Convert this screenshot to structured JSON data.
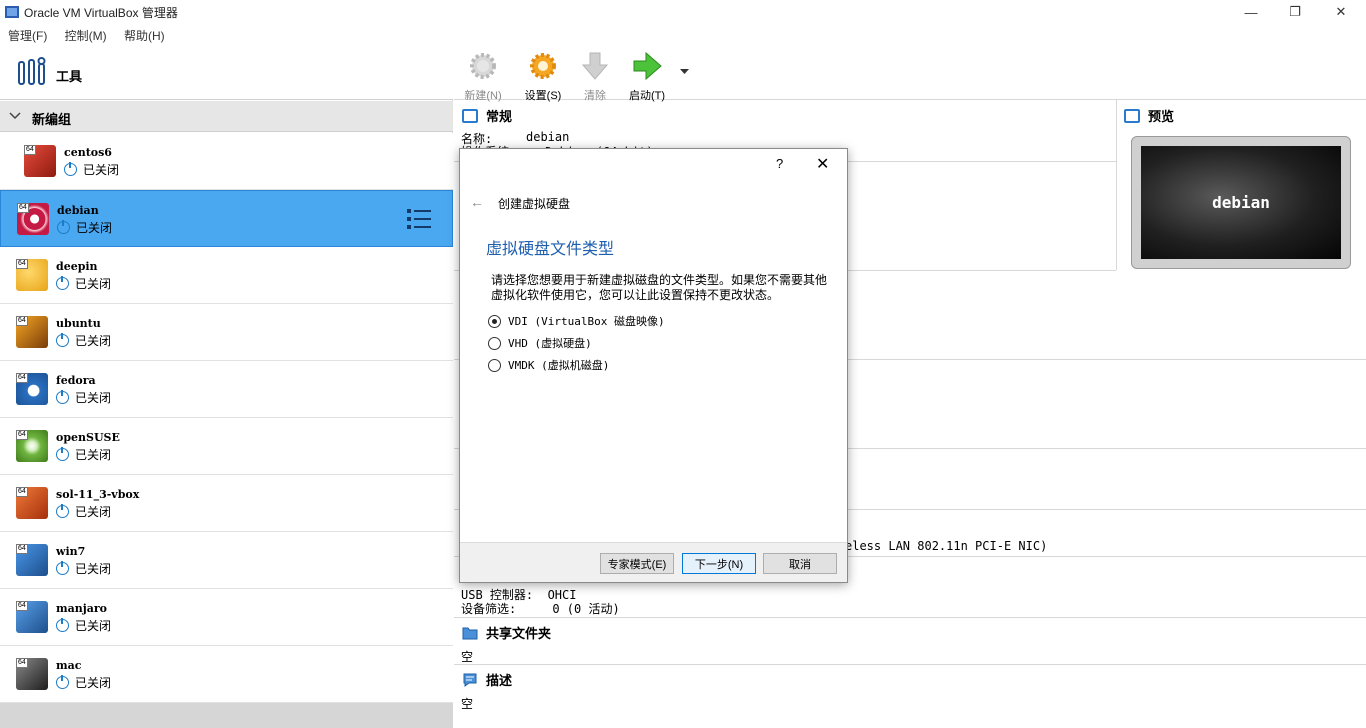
{
  "window": {
    "title": "Oracle VM VirtualBox 管理器",
    "controls": {
      "minimize": "—",
      "restore": "❐",
      "close": "✕"
    }
  },
  "menu": [
    "管理(F)",
    "控制(M)",
    "帮助(H)"
  ],
  "sidebar": {
    "tools_label": "工具",
    "group_label": "新编组",
    "vms": [
      {
        "name": "centos6",
        "status": "已关闭",
        "arch": "64",
        "color": "#c0392b"
      },
      {
        "name": "debian",
        "status": "已关闭",
        "arch": "64",
        "color": "#c41a44",
        "selected": true
      },
      {
        "name": "deepin",
        "status": "已关闭",
        "arch": "64",
        "color": "#f2b134"
      },
      {
        "name": "ubuntu",
        "status": "已关闭",
        "arch": "64",
        "color": "#e08a1e"
      },
      {
        "name": "fedora",
        "status": "已关闭",
        "arch": "64",
        "color": "#2a6fc0"
      },
      {
        "name": "openSUSE",
        "status": "已关闭",
        "arch": "64",
        "color": "#6fb43f"
      },
      {
        "name": "sol-11_3-vbox",
        "status": "已关闭",
        "arch": "64",
        "color": "#e35a1a"
      },
      {
        "name": "win7",
        "status": "已关闭",
        "arch": "64",
        "color": "#2d74c4"
      },
      {
        "name": "manjaro",
        "status": "已关闭",
        "arch": "64",
        "color": "#3a7fd0"
      },
      {
        "name": "mac",
        "status": "已关闭",
        "arch": "64",
        "color": "#3c3c3c"
      }
    ]
  },
  "toolbar": {
    "new_label": "新建(N)",
    "settings_label": "设置(S)",
    "discard_label": "清除",
    "start_label": "启动(T)"
  },
  "details": {
    "general_title": "常规",
    "name_key": "名称:",
    "name_val": "debian",
    "os_fragment": "操作系统:    Debian (64-bit)",
    "preview_title": "预览",
    "preview_text": "debian",
    "nic_fragment": "eless LAN 802.11n PCI-E NIC)",
    "usb_ctrl": "USB 控制器:  OHCI",
    "usb_filter": "设备筛选:     0 (0 活动)",
    "shared_title": "共享文件夹",
    "shared_val": "空",
    "desc_title": "描述",
    "desc_val": "空"
  },
  "dialog": {
    "help": "?",
    "close": "✕",
    "back": "←",
    "wizard_title": "创建虚拟硬盘",
    "heading": "虚拟硬盘文件类型",
    "description": "请选择您想要用于新建虚拟磁盘的文件类型。如果您不需要其他虚拟化软件使用它，您可以让此设置保持不更改状态。",
    "options": [
      {
        "label": "VDI (VirtualBox 磁盘映像)",
        "checked": true
      },
      {
        "label": "VHD (虚拟硬盘)",
        "checked": false
      },
      {
        "label": "VMDK (虚拟机磁盘)",
        "checked": false
      }
    ],
    "expert_button": "专家模式(E)",
    "next_button": "下一步(N)",
    "cancel_button": "取消"
  }
}
